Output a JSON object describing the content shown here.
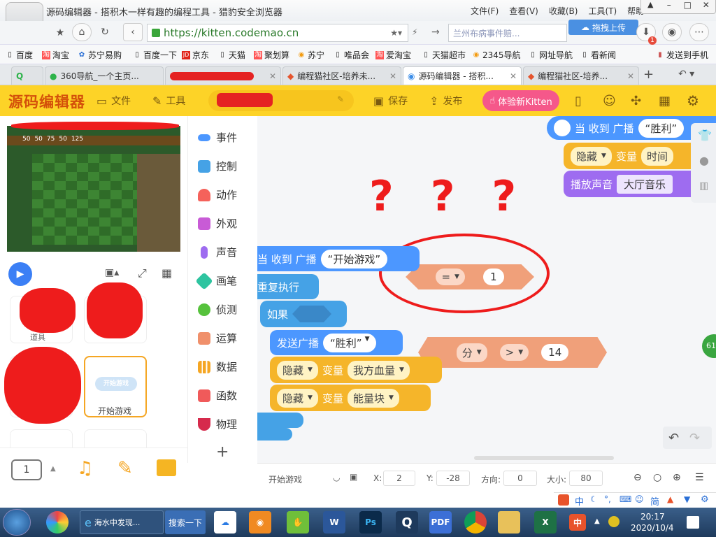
{
  "browser": {
    "window_title": "源码编辑器 - 搭积木一样有趣的编程工具 - 猎豹安全浏览器",
    "menu": [
      "文件(F)",
      "查看(V)",
      "收藏(B)",
      "工具(T)",
      "帮助"
    ],
    "url": "https://kitten.codemao.cn",
    "search_placeholder": "兰州布病事件赔...",
    "drag_upload": "拖拽上传",
    "badge_count": "1",
    "bookmarks": [
      "百度",
      "淘宝",
      "苏宁易购",
      "百度一下",
      "京东",
      "天猫",
      "聚划算",
      "苏宁",
      "唯品会",
      "爱淘宝",
      "天猫超市",
      "2345导航",
      "网址导航",
      "看新闻",
      "发送到手机"
    ],
    "tabs": [
      {
        "label": "360导航_一个主页..."
      },
      {
        "label": ""
      },
      {
        "label": "编程猫社区-培养未..."
      },
      {
        "label": "源码编辑器 - 搭积..."
      },
      {
        "label": "编程猫社区-培养..."
      }
    ],
    "new_tab_symbol": "+"
  },
  "app": {
    "logo": "源码编辑器",
    "file_label": "文件",
    "tools_label": "工具",
    "save_label": "保存",
    "publish_label": "发布",
    "try_new": "体验新Kitten"
  },
  "stage": {
    "scores": [
      "50",
      "50",
      "75",
      "50",
      "125"
    ]
  },
  "sprites": [
    {
      "name": "道具"
    },
    {
      "name": "开始游戏",
      "thumb": "开始游戏"
    }
  ],
  "page_selector": "1",
  "categories": [
    {
      "label": "事件",
      "color": "#4c97ff"
    },
    {
      "label": "控制",
      "color": "#45a2e6"
    },
    {
      "label": "动作",
      "color": "#f5625b"
    },
    {
      "label": "外观",
      "color": "#c85bd6"
    },
    {
      "label": "声音",
      "color": "#9e6cf0"
    },
    {
      "label": "画笔",
      "color": "#2ec4a0"
    },
    {
      "label": "侦测",
      "color": "#56c23c"
    },
    {
      "label": "运算",
      "color": "#f0906b"
    },
    {
      "label": "数据",
      "color": "#f5a623"
    },
    {
      "label": "函数",
      "color": "#f05a5a"
    },
    {
      "label": "物理",
      "color": "#d62a4c"
    }
  ],
  "add_extension": "+",
  "scripts": {
    "top": {
      "event": "当 收到 广播",
      "event_msg": "“胜利”",
      "hide": "隐藏",
      "variable": "变量",
      "var_name": "时间",
      "play_sound": "播放声音",
      "sound_name": "大厅音乐"
    },
    "main": {
      "event": "当 收到 广播",
      "event_msg": "“开始游戏”",
      "repeat": "重复执行",
      "if": "如果",
      "send": "发送广播",
      "send_msg": "“胜利”",
      "hide1": "隐藏",
      "var1_label": "变量",
      "var1": "我方血量",
      "hide2": "隐藏",
      "var2_label": "变量",
      "var2": "能量块"
    },
    "loose_eq": {
      "op": "=",
      "value": "1"
    },
    "loose_gt": {
      "var": "分",
      "op": ">",
      "value": "14"
    },
    "annotation": "? ? ?"
  },
  "side_badge": "61",
  "statusbar": {
    "sprite": "开始游戏",
    "x_label": "X:",
    "x": "2",
    "y_label": "Y:",
    "y": "-28",
    "dir_label": "方向:",
    "dir": "0",
    "size_label": "大小:",
    "size": "80"
  },
  "ime": [
    "中",
    "简"
  ],
  "taskbar": {
    "items": [
      "海水中发现...",
      "搜索一下"
    ],
    "time": "20:17",
    "date": "2020/10/4"
  }
}
